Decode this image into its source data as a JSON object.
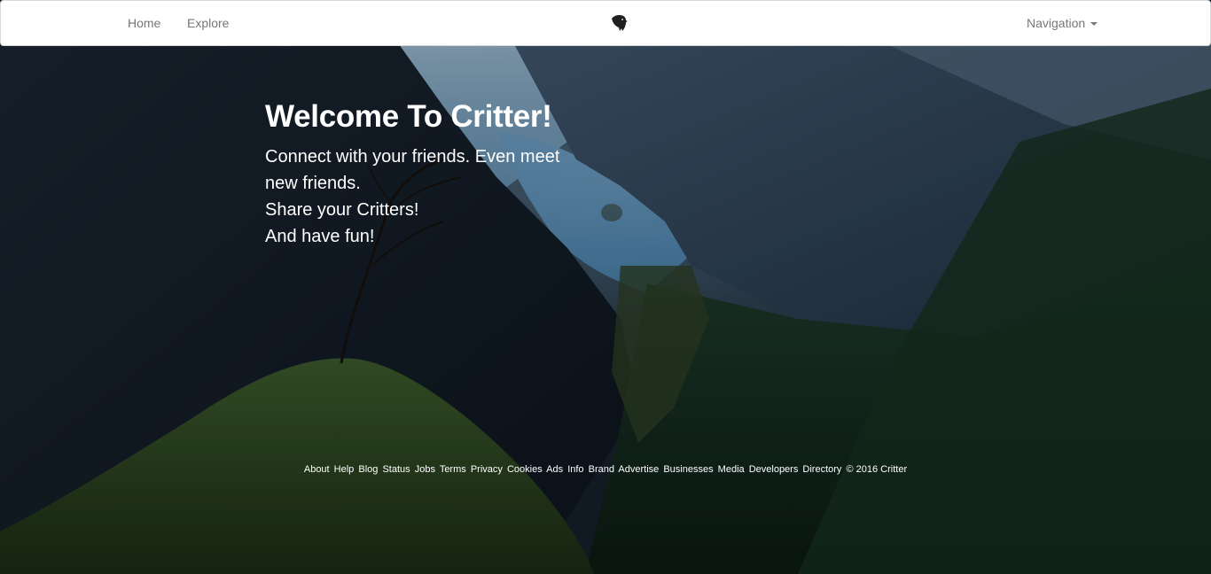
{
  "navbar": {
    "links": [
      "Home",
      "Explore"
    ],
    "brand_icon": "raven-logo-icon",
    "dropdown_label": "Navigation"
  },
  "hero": {
    "title": "Welcome To Critter!",
    "lines": [
      "Connect with your friends. Even meet new friends.",
      "Share your Critters!",
      "And have fun!"
    ]
  },
  "footer": {
    "links": [
      "About",
      "Help",
      "Blog",
      "Status",
      "Jobs",
      "Terms",
      "Privacy",
      "Cookies",
      "Ads",
      "Info",
      "Brand",
      "Advertise",
      "Businesses",
      "Media",
      "Developers",
      "Directory"
    ],
    "copyright": "© 2016 Critter"
  },
  "colors": {
    "navbar_bg": "#ffffff",
    "nav_text": "#777777",
    "hero_text": "#ffffff"
  }
}
